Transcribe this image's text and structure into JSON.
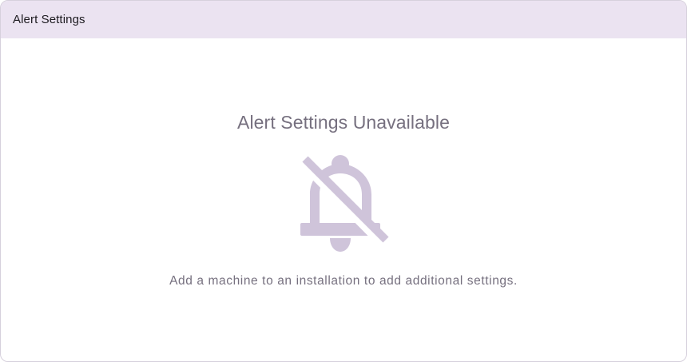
{
  "card": {
    "title": "Alert Settings"
  },
  "empty_state": {
    "title": "Alert Settings Unavailable",
    "icon": "bell-off-icon",
    "message": "Add a machine to an installation to add additional settings."
  },
  "colors": {
    "header_background": "#ebe3f1",
    "muted_text": "#76707f",
    "icon": "#cfc4da"
  }
}
